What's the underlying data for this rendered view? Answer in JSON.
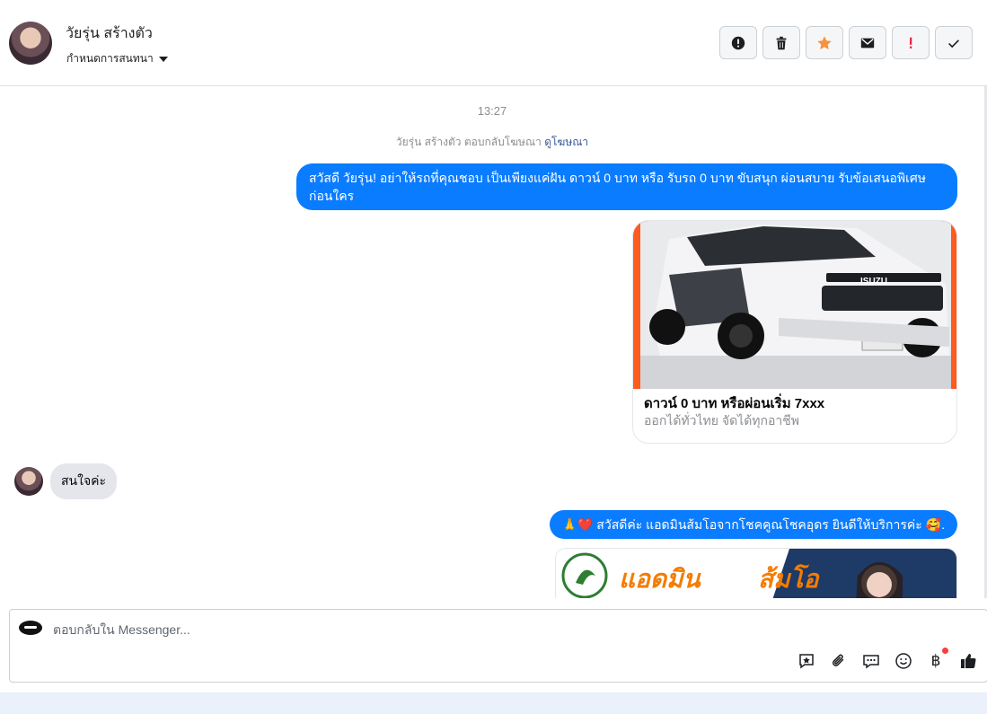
{
  "header": {
    "contact_name": "วัยรุ่น สร้างตัว",
    "assign_label": "กำหนดการสนทนา",
    "tools": [
      {
        "icon": "alert-circle-icon"
      },
      {
        "icon": "trash-icon"
      },
      {
        "icon": "star-icon",
        "color": "#f7923b"
      },
      {
        "icon": "envelope-icon"
      },
      {
        "icon": "exclamation-icon",
        "color": "#e41e3f"
      },
      {
        "icon": "check-icon"
      }
    ]
  },
  "conversation": {
    "time": "13:27",
    "replied_text": "วัยรุ่น สร้างตัว ตอบกลับโฆษณา",
    "replied_link": "ดูโฆษณา",
    "message_1": "สวัสดี วัยรุ่น! อย่าให้รถที่คุณชอบ เป็นเพียงแค่ฝัน ดาวน์ 0 บาท หรือ รับรถ 0 บาท ขับสนุก ผ่อนสบาย รับข้อเสนอพิเศษก่อนใคร",
    "card": {
      "title": "ดาวน์ 0 บาท หรือผ่อนเริ่ม 7xxx",
      "subtitle": "ออกได้ทั่วไทย จัดได้ทุกอาชีพ",
      "image_brand": "ISUZU"
    },
    "message_in": "สนใจค่ะ",
    "message_2": "🙏❤️ สวัสดีค่ะ แอดมินส้มโอจากโชคคูณโชคอุดร ยินดีให้บริการค่ะ 🥰.",
    "promo_text_1": "แอดมิน",
    "promo_text_2": "ส้มโอ"
  },
  "composer": {
    "placeholder": "ตอบกลับใน Messenger...",
    "baht_symbol": "฿",
    "icons": [
      "saved-reply-icon",
      "attachment-icon",
      "chat-bubbles-icon",
      "emoji-icon",
      "baht-icon",
      "like-icon"
    ]
  },
  "colors": {
    "outgoing_bubble": "#0a7cff",
    "incoming_bubble": "#e4e6eb",
    "card_image_bg": "#ff5a1f"
  }
}
